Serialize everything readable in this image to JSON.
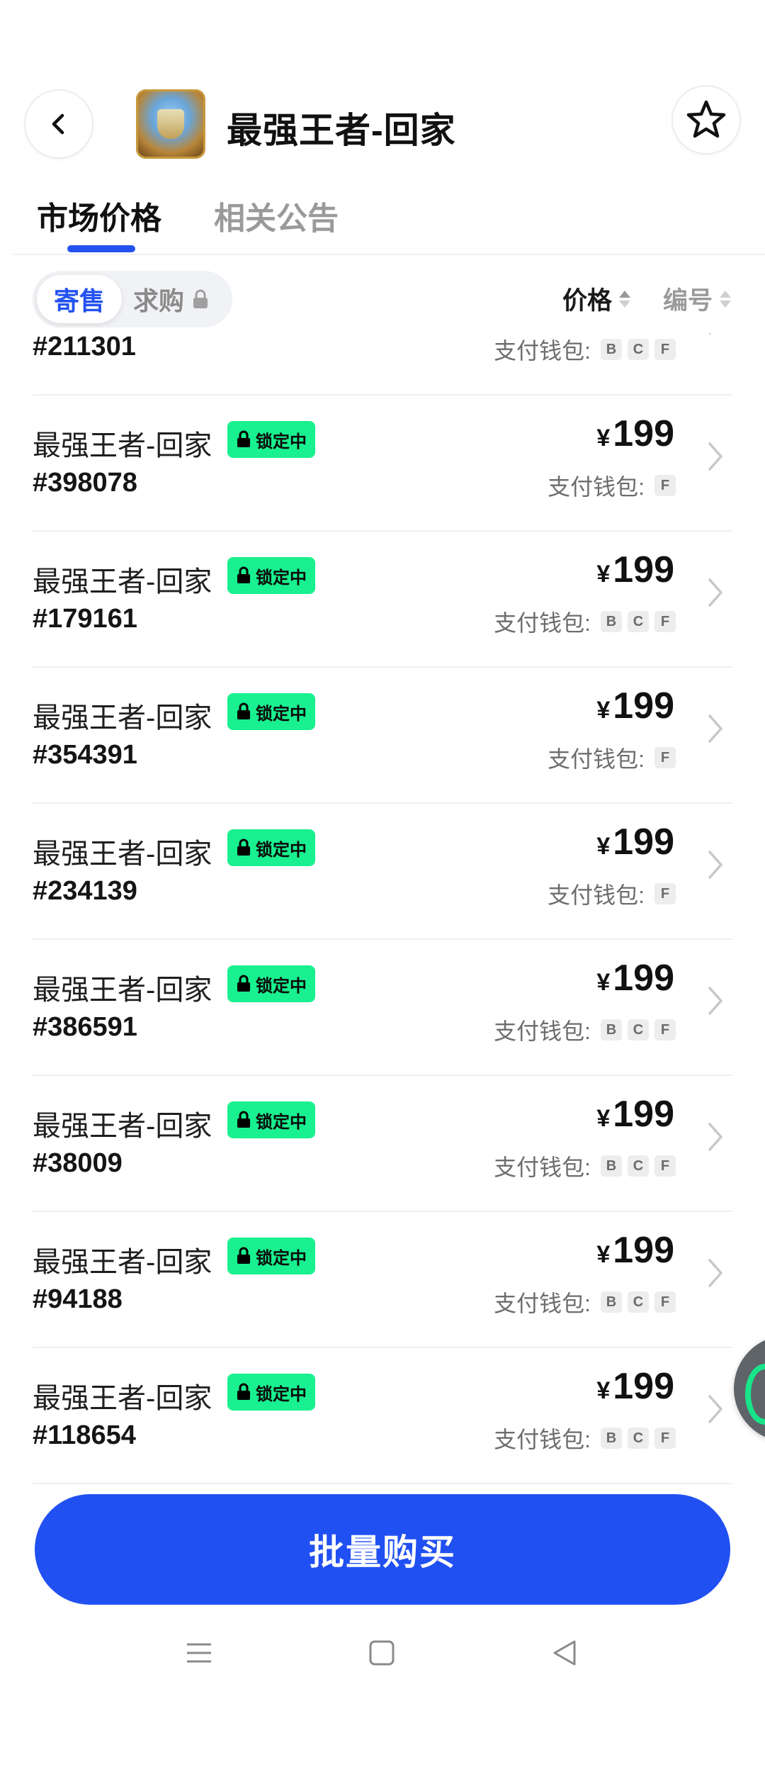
{
  "header": {
    "title": "最强王者-回家",
    "back_icon": "chevron-left-icon",
    "favorite_icon": "star-outline-icon"
  },
  "tabs": [
    {
      "label": "市场价格",
      "active": true
    },
    {
      "label": "相关公告",
      "active": false
    }
  ],
  "filter": {
    "segments": [
      {
        "label": "寄售",
        "active": true
      },
      {
        "label": "求购",
        "active": false,
        "locked": true
      }
    ],
    "sort_price_label": "价格",
    "sort_number_label": "编号"
  },
  "list": {
    "wallet_label": "支付钱包:",
    "lock_badge_label": "锁定中",
    "currency_symbol": "¥",
    "partial_top_row": {
      "id": "#211301",
      "wallets": [
        "B",
        "C",
        "F"
      ]
    },
    "items": [
      {
        "name": "最强王者-回家",
        "id": "#398078",
        "price": "199",
        "wallets": [
          "F"
        ]
      },
      {
        "name": "最强王者-回家",
        "id": "#179161",
        "price": "199",
        "wallets": [
          "B",
          "C",
          "F"
        ]
      },
      {
        "name": "最强王者-回家",
        "id": "#354391",
        "price": "199",
        "wallets": [
          "F"
        ]
      },
      {
        "name": "最强王者-回家",
        "id": "#234139",
        "price": "199",
        "wallets": [
          "F"
        ]
      },
      {
        "name": "最强王者-回家",
        "id": "#386591",
        "price": "199",
        "wallets": [
          "B",
          "C",
          "F"
        ]
      },
      {
        "name": "最强王者-回家",
        "id": "#38009",
        "price": "199",
        "wallets": [
          "B",
          "C",
          "F"
        ]
      },
      {
        "name": "最强王者-回家",
        "id": "#94188",
        "price": "199",
        "wallets": [
          "B",
          "C",
          "F"
        ]
      },
      {
        "name": "最强王者-回家",
        "id": "#118654",
        "price": "199",
        "wallets": [
          "B",
          "C",
          "F"
        ]
      }
    ]
  },
  "bottom": {
    "batch_buy_label": "批量购买"
  },
  "colors": {
    "accent": "#2352f0",
    "lock_badge": "#19f08f"
  }
}
